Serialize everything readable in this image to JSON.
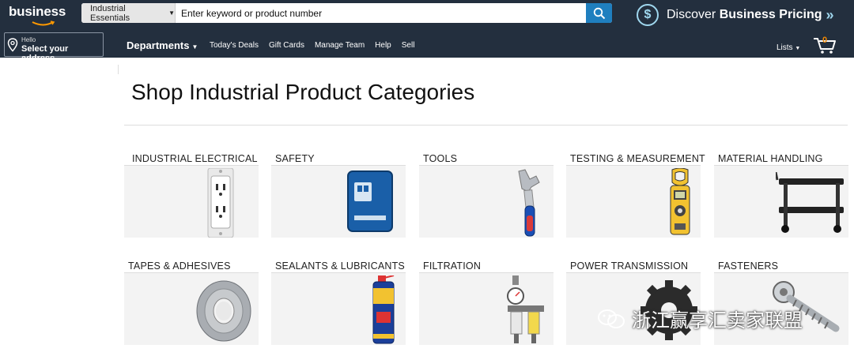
{
  "header": {
    "logo": "business",
    "search": {
      "category": "Industrial Essentials",
      "placeholder": "Enter keyword or product number",
      "value": ""
    },
    "promo": {
      "text_pre": "Discover ",
      "text_bold": "Business Pricing",
      "arrows": "»"
    }
  },
  "nav": {
    "address_hello": "Hello",
    "address_main": "Select your address",
    "departments": "Departments",
    "links": [
      "Today's Deals",
      "Gift Cards",
      "Manage Team",
      "Help",
      "Sell"
    ],
    "lists": "Lists",
    "cart_count": "0"
  },
  "main": {
    "title": "Shop Industrial Product Categories",
    "categories": [
      "INDUSTRIAL ELECTRICAL",
      "SAFETY",
      "TOOLS",
      "TESTING & MEASUREMENT",
      "MATERIAL HANDLING",
      "TAPES & ADHESIVES",
      "SEALANTS & LUBRICANTS",
      "FILTRATION",
      "POWER TRANSMISSION",
      "FASTENERS"
    ]
  },
  "watermark": "浙江赢享汇卖家联盟",
  "colors": {
    "topbar": "#232f3e",
    "search_button": "#1f7fbf",
    "promo_accent": "#9fd7ee",
    "cart_count": "#f08804"
  }
}
